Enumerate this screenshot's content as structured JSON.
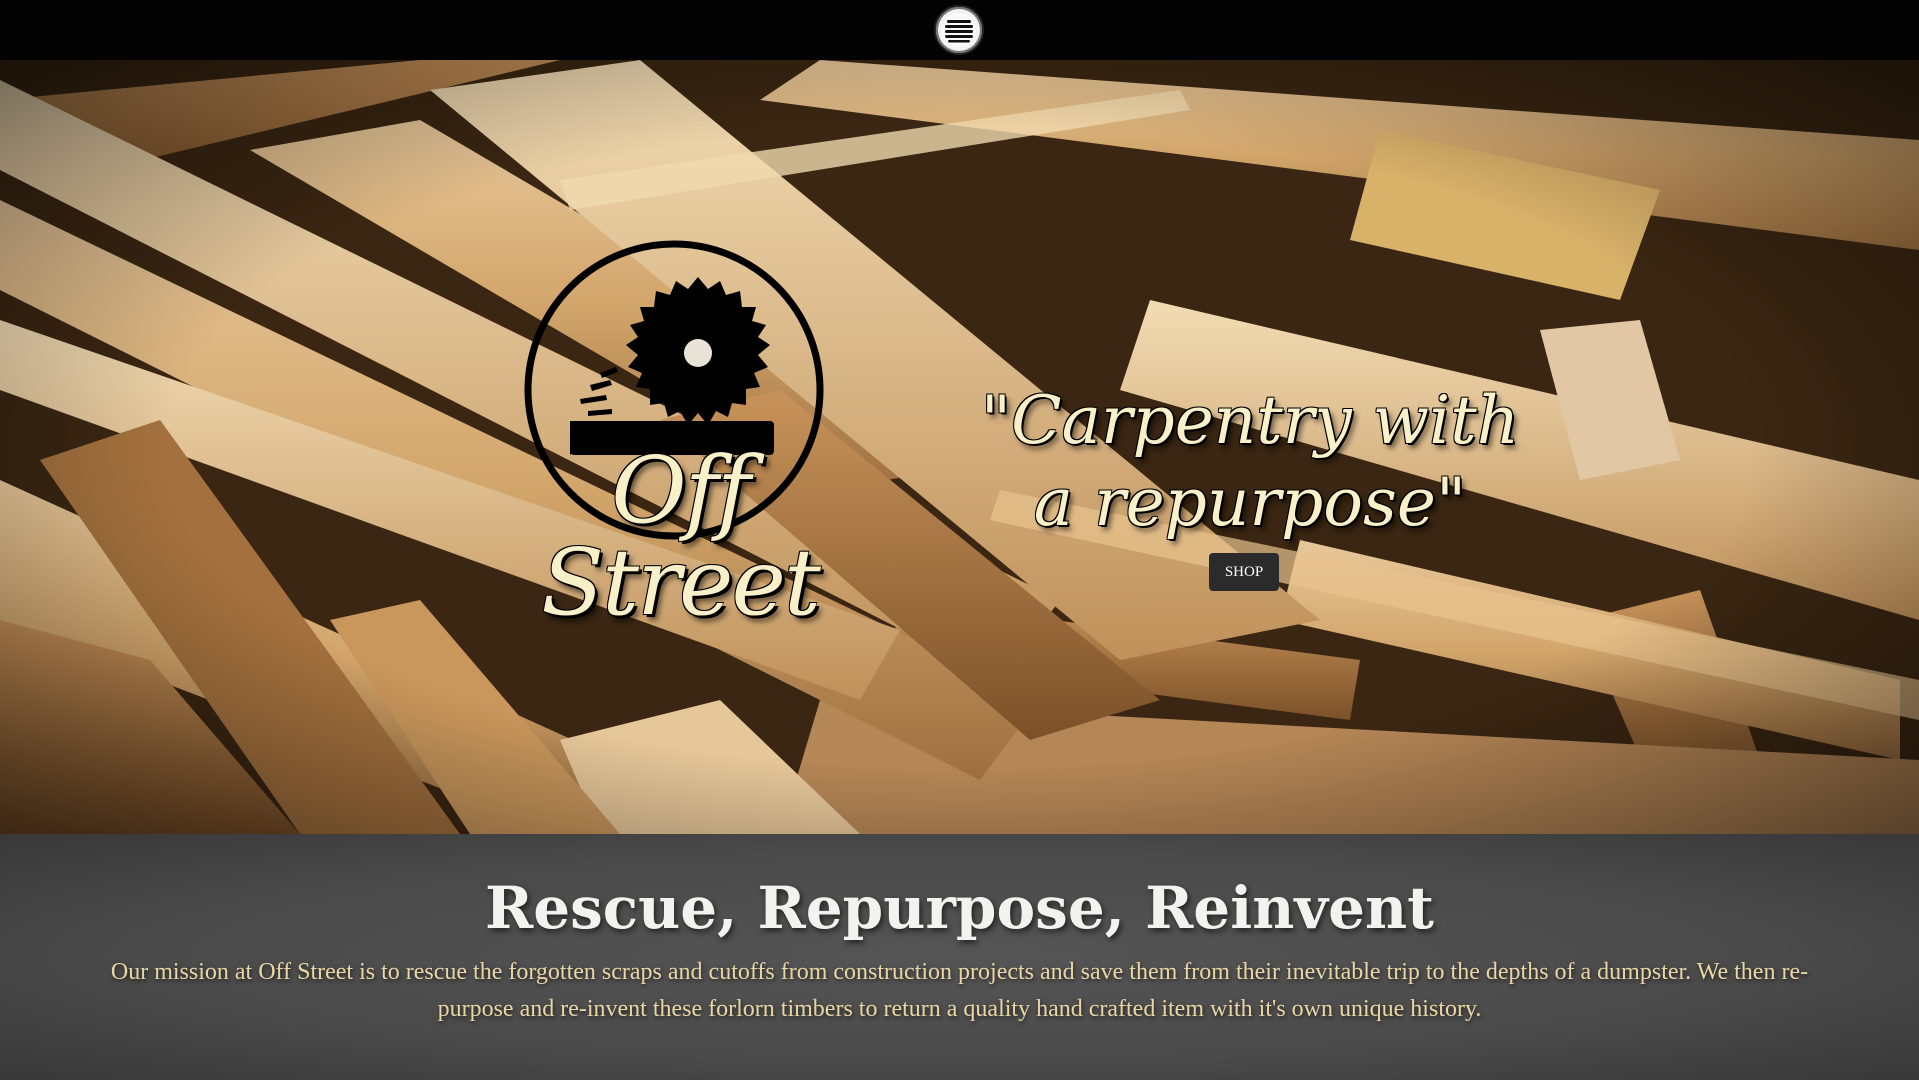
{
  "header": {
    "menu_icon": "hamburger-icon"
  },
  "hero": {
    "logo_text": "Off Street",
    "logo_icon": "circular-saw-icon",
    "tagline_line1": "\"Carpentry with",
    "tagline_line2": "a repurpose\"",
    "shop_label": "SHOP"
  },
  "mission": {
    "title": "Rescue, Repurpose, Reinvent",
    "text": "Our mission at Off Street is to rescue the forgotten scraps and cutoffs from construction projects and save them from their inevitable trip to the depths of a dumpster. We then re-purpose and re-invent these forlorn timbers to return a quality hand crafted item with it's own unique history."
  },
  "colors": {
    "topbar": "#030303",
    "mission_bg": "#4a4a4a",
    "mission_text": "#e8d6a4",
    "logo_text": "#f8f0c8",
    "shop_button": "#2b2b2b"
  }
}
